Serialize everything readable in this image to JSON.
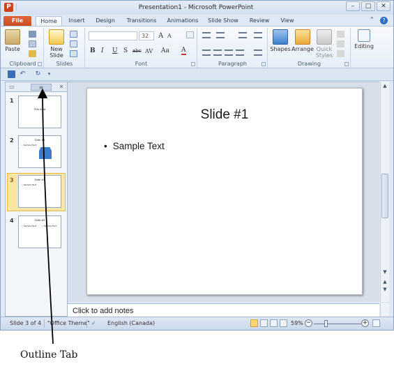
{
  "window": {
    "title": "Presentation1 - Microsoft PowerPoint",
    "app_icon_letter": "P",
    "controls": [
      "–",
      "□",
      "✕"
    ]
  },
  "tabs": [
    {
      "label": "File"
    },
    {
      "label": "Home"
    },
    {
      "label": "Insert"
    },
    {
      "label": "Design"
    },
    {
      "label": "Transitions"
    },
    {
      "label": "Animations"
    },
    {
      "label": "Slide Show"
    },
    {
      "label": "Review"
    },
    {
      "label": "View"
    }
  ],
  "ribbon": {
    "clipboard": {
      "label": "Clipboard",
      "paste": "Paste"
    },
    "slides": {
      "label": "Slides",
      "new_slide": "New Slide"
    },
    "font": {
      "label": "Font",
      "font_name": "",
      "font_size": "32",
      "bold": "B",
      "italic": "I",
      "underline": "U",
      "shadow": "S",
      "strike": "abc",
      "spacing": "AV",
      "case": "Aa",
      "color": "A",
      "grow": "A",
      "shrink": "A"
    },
    "paragraph": {
      "label": "Paragraph"
    },
    "drawing": {
      "label": "Drawing",
      "shapes": "Shapes",
      "arrange": "Arrange",
      "quick_styles": "Quick Styles"
    },
    "editing": {
      "label": "Editing"
    }
  },
  "left_pane": {
    "tabs": [
      "Slides",
      "Outline"
    ],
    "thumbnails": [
      {
        "number": "1",
        "title": "Title Slide",
        "bullet": ""
      },
      {
        "number": "2",
        "title": "Slide #2",
        "bullet": "• Sample Text"
      },
      {
        "number": "3",
        "title": "Slide #1",
        "bullet": "• Sample Text"
      },
      {
        "number": "4",
        "title": "Slide #4",
        "bullet": "• Sample Text"
      }
    ],
    "selected_index": 3
  },
  "slide": {
    "title": "Slide #1",
    "bullet": "Sample Text"
  },
  "notes": {
    "placeholder": "Click to add notes"
  },
  "status": {
    "slide_counter": "Slide 3 of 4",
    "theme": "\"Office Theme\"",
    "language": "English (Canada)",
    "zoom": "59%"
  },
  "annotation": {
    "label": "Outline Tab"
  },
  "colors": {
    "file_tab": "#c84a1f",
    "selected_thumb": "#fbe5a6",
    "accent": "#2e6fc1"
  }
}
